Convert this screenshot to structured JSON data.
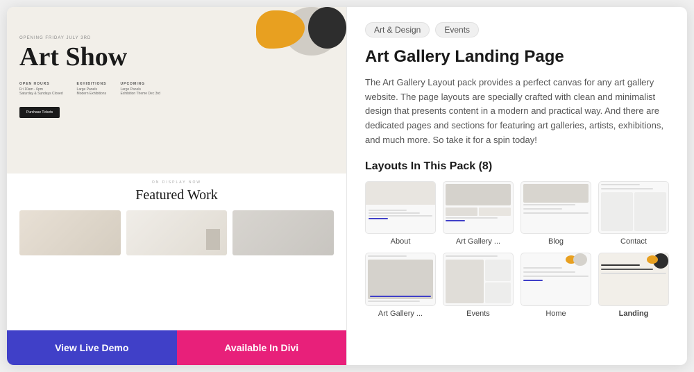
{
  "tags": [
    "Art & Design",
    "Events"
  ],
  "title": "Art Gallery Landing Page",
  "description": "The Art Gallery Layout pack provides a perfect canvas for any art gallery website. The page layouts are specially crafted with clean and minimalist design that presents content in a modern and practical way. And there are dedicated pages and sections for featuring art galleries, artists, exhibitions, and much more. So take it for a spin today!",
  "layouts_title": "Layouts In This Pack (8)",
  "layouts": [
    {
      "label": "About",
      "type": "about"
    },
    {
      "label": "Art Gallery ...",
      "type": "gallery"
    },
    {
      "label": "Blog",
      "type": "blog"
    },
    {
      "label": "Contact",
      "type": "contact"
    },
    {
      "label": "Art Gallery ...",
      "type": "gallery2"
    },
    {
      "label": "Events",
      "type": "events"
    },
    {
      "label": "Home",
      "type": "home"
    },
    {
      "label": "Landing",
      "type": "landing"
    }
  ],
  "preview": {
    "opening_text": "Opening Friday July 3rd",
    "art_show_title": "Art Show",
    "open_hours_label": "Open Hours",
    "open_hours_val": "Fri 10am - 6pm\nSaturday & Sundays Closed",
    "exhibitions_label": "Exhibitions",
    "exhibitions_val": "Large Panels\nModern Exhibitions",
    "upcoming_label": "Upcoming",
    "upcoming_val": "Large Panels\nExhibition Theme Dec 3rd",
    "purchase_btn": "Purchase Tickets",
    "on_display": "On Display Now",
    "featured_title": "Featured Work"
  },
  "buttons": {
    "demo": "View Live Demo",
    "divi": "Available In Divi"
  }
}
